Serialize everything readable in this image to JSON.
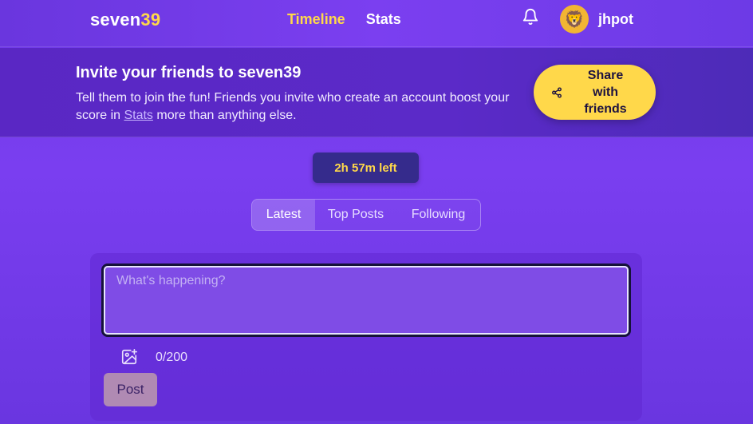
{
  "header": {
    "logo_text": "seven",
    "logo_accent": "39",
    "nav": [
      {
        "label": "Timeline",
        "active": true
      },
      {
        "label": "Stats",
        "active": false
      }
    ],
    "username": "jhpot",
    "avatar_emoji": "🦁"
  },
  "banner": {
    "title": "Invite your friends to seven39",
    "text_before": "Tell them to join the fun! Friends you invite who create an account boost your score in ",
    "link_text": "Stats",
    "text_after": " more than anything else.",
    "share_label": "Share with friends"
  },
  "timer": {
    "label": "2h 57m left"
  },
  "tabs": [
    {
      "label": "Latest",
      "active": true
    },
    {
      "label": "Top Posts",
      "active": false
    },
    {
      "label": "Following",
      "active": false
    }
  ],
  "composer": {
    "placeholder": "What's happening?",
    "value": "",
    "counter": "0/200",
    "post_label": "Post"
  },
  "colors": {
    "accent": "#ffd84a",
    "background": "#7a3ef0",
    "banner": "#5a27c4",
    "timer_bg": "#352b8c"
  },
  "icons": [
    "bell-icon",
    "share-icon",
    "image-add-icon"
  ]
}
